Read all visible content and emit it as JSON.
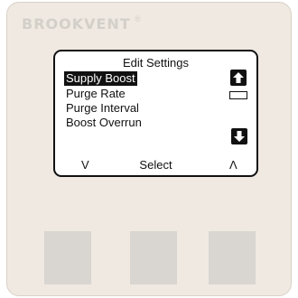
{
  "device": {
    "brand": "BROOKVENT",
    "brand_mark": "®"
  },
  "screen": {
    "title": "Edit Settings",
    "menu_items": [
      {
        "label": "Supply Boost",
        "selected": true
      },
      {
        "label": "Purge Rate",
        "selected": false
      },
      {
        "label": "Purge Interval",
        "selected": false
      },
      {
        "label": "Boost Overrun",
        "selected": false
      }
    ],
    "softkeys": {
      "down": "V",
      "select": "Select",
      "up": "Λ"
    },
    "scroll_icons": {
      "up": "arrow-up-icon",
      "down": "arrow-down-icon"
    }
  },
  "buttons": [
    {
      "name": "hardware-button-left"
    },
    {
      "name": "hardware-button-middle"
    },
    {
      "name": "hardware-button-right"
    }
  ],
  "colors": {
    "panel": "#efe9e1",
    "screen": "#ffffff",
    "text": "#111111",
    "button": "#d9d5d0",
    "brand": "#d3cfc9"
  }
}
